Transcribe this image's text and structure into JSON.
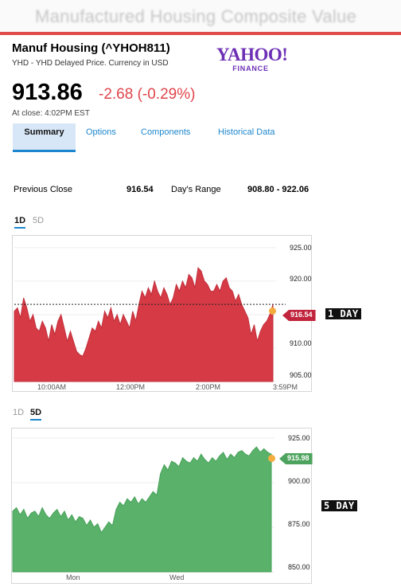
{
  "page": {
    "title": "Manufactured Housing Composite Value"
  },
  "quote": {
    "name": "Manuf Housing (^YHOH811)",
    "subtitle": "YHD - YHD Delayed Price. Currency in USD",
    "price": "913.86",
    "change": "-2.68 (-0.29%)",
    "close_time": "At close: 4:02PM EST"
  },
  "logo": {
    "brand": "YAHOO!",
    "sub": "FINANCE"
  },
  "colors": {
    "accent": "#1d86ce",
    "negative": "#e0454b",
    "chart_red": "#d63a45",
    "chart_green": "#5ab26a",
    "marker_dot": "#f3ad3f",
    "brand": "#6d2fb5"
  },
  "tabs": [
    "Summary",
    "Options",
    "Components",
    "Historical Data"
  ],
  "stats": {
    "prev_close_label": "Previous Close",
    "prev_close_value": "916.54",
    "days_range_label": "Day's Range",
    "days_range_value": "908.80 - 922.06"
  },
  "charts": {
    "one_day": {
      "range_tabs": [
        "1D",
        "5D"
      ],
      "active_tab": "1D",
      "y_ticks": [
        "925.00",
        "920.00",
        "915.00",
        "910.00",
        "905.00"
      ],
      "x_ticks": [
        "10:00AM",
        "12:00PM",
        "2:00PM",
        "3:59PM"
      ],
      "marker": "916.54",
      "label": "1 DAY"
    },
    "five_day": {
      "range_tabs": [
        "1D",
        "5D"
      ],
      "active_tab": "5D",
      "y_ticks": [
        "925.00",
        "900.00",
        "875.00",
        "850.00"
      ],
      "x_ticks": [
        "Mon",
        "Wed"
      ],
      "marker": "915.98",
      "label": "5 DAY"
    }
  },
  "chart_data": [
    {
      "type": "area",
      "ylim": [
        905,
        925
      ],
      "reference_line": 916.54,
      "y": [
        915.5,
        916,
        914.5,
        917.5,
        916,
        914,
        915,
        913,
        912.5,
        914,
        913,
        911,
        913.5,
        912,
        914,
        915,
        913,
        911,
        912.5,
        911,
        909.5,
        909,
        908.8,
        910,
        911.5,
        913,
        912.5,
        914,
        913,
        915.5,
        914.5,
        916,
        914,
        915,
        913.5,
        915,
        914,
        913,
        915.5,
        914,
        916.5,
        918.5,
        917.5,
        919,
        918,
        920,
        918.5,
        917.5,
        919,
        918,
        916.5,
        917.5,
        919.5,
        918.5,
        920,
        919,
        921,
        920.5,
        919,
        922,
        921.5,
        920,
        919.5,
        918.5,
        918.5,
        919.5,
        918.5,
        920,
        920.5,
        919,
        918.5,
        917,
        918,
        916.5,
        915.5,
        914.5,
        912,
        913.5,
        911,
        912.5,
        913.5,
        914,
        915,
        916.5
      ]
    },
    {
      "type": "area",
      "ylim": [
        850,
        925
      ],
      "y": [
        884,
        886,
        882,
        885,
        880,
        883,
        884,
        881,
        886,
        882,
        880,
        883,
        885,
        881,
        884,
        879,
        882,
        878,
        881,
        880,
        876,
        879,
        875,
        877,
        872,
        875,
        878,
        876,
        885,
        889,
        887,
        891,
        889,
        892,
        888,
        891,
        889,
        892,
        895,
        893,
        905,
        910,
        907,
        912,
        911,
        909,
        914,
        912,
        911,
        914,
        912,
        916,
        913,
        911,
        914,
        912,
        915,
        917,
        913,
        916,
        914,
        917,
        918,
        916,
        915,
        918,
        920,
        917,
        919,
        917,
        916
      ]
    }
  ]
}
